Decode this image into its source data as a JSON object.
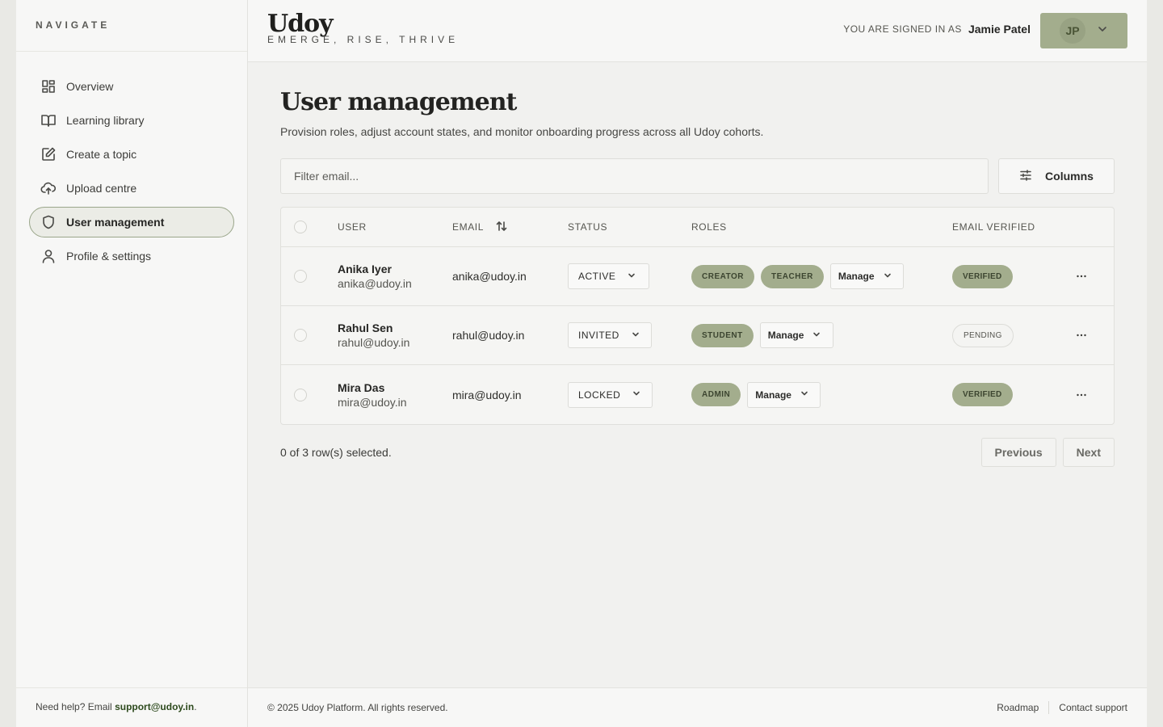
{
  "sidebar": {
    "heading": "NAVIGATE",
    "items": [
      {
        "label": "Overview",
        "icon": "grid-icon"
      },
      {
        "label": "Learning library",
        "icon": "book-icon"
      },
      {
        "label": "Create a topic",
        "icon": "edit-icon"
      },
      {
        "label": "Upload centre",
        "icon": "cloud-upload-icon"
      },
      {
        "label": "User management",
        "icon": "shield-icon",
        "active": true
      },
      {
        "label": "Profile & settings",
        "icon": "user-icon"
      }
    ],
    "help_text": "Need help? Email ",
    "help_email": "support@udoy.in",
    "help_suffix": "."
  },
  "header": {
    "brand": "Udoy",
    "tagline": "EMERGE, RISE, THRIVE",
    "signed_in_label": "YOU ARE SIGNED IN AS",
    "user_name": "Jamie Patel",
    "initials": "JP"
  },
  "main": {
    "title": "User management",
    "subtitle": "Provision roles, adjust account states, and monitor onboarding progress across all Udoy cohorts.",
    "filter_placeholder": "Filter email...",
    "columns_label": "Columns",
    "table": {
      "headers": {
        "user": "USER",
        "email": "EMAIL",
        "status": "STATUS",
        "roles": "ROLES",
        "verified": "EMAIL VERIFIED"
      },
      "rows": [
        {
          "name": "Anika Iyer",
          "handle": "anika@udoy.in",
          "email": "anika@udoy.in",
          "status": "ACTIVE",
          "roles": [
            "CREATOR",
            "TEACHER"
          ],
          "verified": "VERIFIED"
        },
        {
          "name": "Rahul Sen",
          "handle": "rahul@udoy.in",
          "email": "rahul@udoy.in",
          "status": "INVITED",
          "roles": [
            "STUDENT"
          ],
          "verified": "PENDING"
        },
        {
          "name": "Mira Das",
          "handle": "mira@udoy.in",
          "email": "mira@udoy.in",
          "status": "LOCKED",
          "roles": [
            "ADMIN"
          ],
          "verified": "VERIFIED"
        }
      ],
      "manage_label": "Manage"
    },
    "selection_text": "0 of 3 row(s) selected.",
    "prev_label": "Previous",
    "next_label": "Next"
  },
  "footer": {
    "copyright": "© 2025 Udoy Platform. All rights reserved.",
    "roadmap": "Roadmap",
    "contact": "Contact support"
  },
  "colors": {
    "accent": "#a3ad8d",
    "background": "#f1f1ef",
    "active_border": "#9aa68a"
  }
}
